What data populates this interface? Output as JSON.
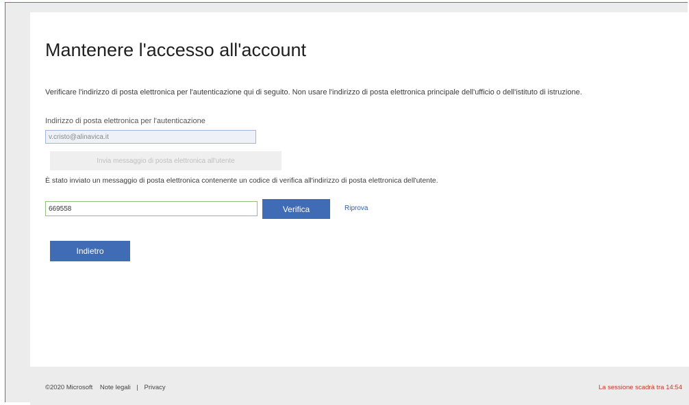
{
  "page": {
    "title": "Mantenere l'accesso all'account",
    "description": "Verificare l'indirizzo di posta elettronica per l'autenticazione qui di seguito. Non usare l'indirizzo di posta elettronica principale dell'ufficio o dell'istituto di istruzione."
  },
  "auth_email": {
    "label": "Indirizzo di posta elettronica per l'autenticazione",
    "value": "v.cristo@alinavica.it"
  },
  "send_button": {
    "label": "Invia messaggio di posta elettronica all'utente"
  },
  "info_message": "È stato inviato un messaggio di posta elettronica contenente un codice di verifica all'indirizzo di posta elettronica dell'utente.",
  "code_input": {
    "value": "669558"
  },
  "verify_button": {
    "label": "Verifica"
  },
  "retry_link": {
    "label": "Riprova"
  },
  "back_button": {
    "label": "Indietro"
  },
  "footer": {
    "copyright": "©2020 Microsoft",
    "legal": "Note legali",
    "separator": "|",
    "privacy": "Privacy"
  },
  "session": {
    "text": "La sessione scadrà tra 14:54"
  },
  "colors": {
    "primary_button": "#3f6cb5",
    "session_warning": "#c23b2b",
    "code_border": "#8fc07c"
  }
}
